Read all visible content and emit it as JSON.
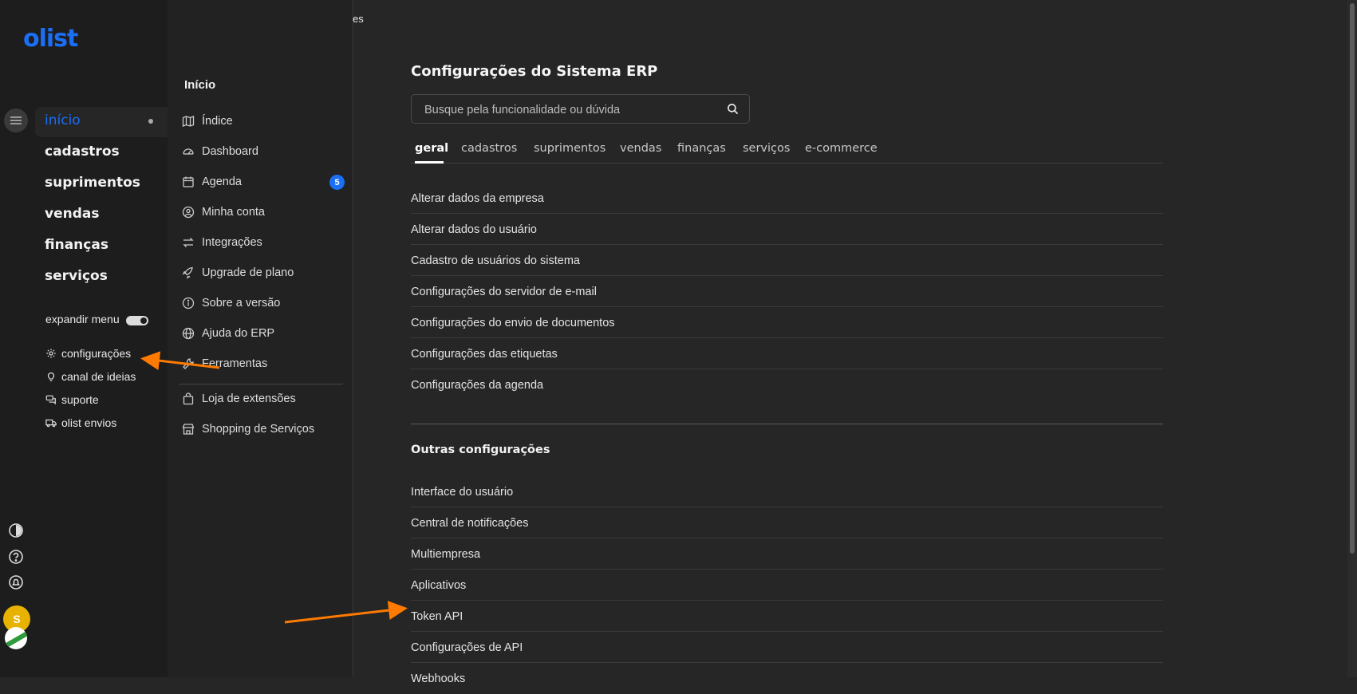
{
  "rail": {
    "logo": "olist",
    "nav": [
      {
        "label": "início",
        "active": true
      },
      {
        "label": "cadastros"
      },
      {
        "label": "suprimentos"
      },
      {
        "label": "vendas"
      },
      {
        "label": "finanças"
      },
      {
        "label": "serviços"
      }
    ],
    "expand_menu_label": "expandir menu",
    "utilities": [
      {
        "label": "configurações",
        "icon": "gear-icon"
      },
      {
        "label": "canal de ideias",
        "icon": "lightbulb-icon"
      },
      {
        "label": "suporte",
        "icon": "chat-icon"
      },
      {
        "label": "olist envios",
        "icon": "truck-icon"
      }
    ],
    "avatar_initial": "S",
    "avatar_color": "#e8b300",
    "accent_color": "#1a6ff5"
  },
  "submenu": {
    "title": "Início",
    "items": [
      {
        "label": "Índice",
        "icon": "map-icon"
      },
      {
        "label": "Dashboard",
        "icon": "gauge-icon"
      },
      {
        "label": "Agenda",
        "icon": "calendar-icon",
        "badge": "5"
      },
      {
        "label": "Minha conta",
        "icon": "user-circle-icon"
      },
      {
        "label": "Integrações",
        "icon": "swap-icon"
      },
      {
        "label": "Upgrade de plano",
        "icon": "rocket-icon"
      },
      {
        "label": "Sobre a versão",
        "icon": "info-icon"
      },
      {
        "label": "Ajuda do ERP",
        "icon": "globe-icon"
      },
      {
        "label": "Ferramentas",
        "icon": "wrench-icon"
      },
      {
        "label": "Loja de extensões",
        "icon": "bag-icon"
      },
      {
        "label": "Shopping de Serviços",
        "icon": "store-icon"
      }
    ],
    "top_stub": "es"
  },
  "main": {
    "title": "Configurações do Sistema ERP",
    "search": {
      "placeholder": "Busque pela funcionalidade ou dúvida",
      "value": ""
    },
    "tabs": [
      "geral",
      "cadastros",
      "suprimentos",
      "vendas",
      "finanças",
      "serviços",
      "e-commerce"
    ],
    "active_tab": "geral",
    "general_items": [
      "Alterar dados da empresa",
      "Alterar dados do usuário",
      "Cadastro de usuários do sistema",
      "Configurações do servidor de e-mail",
      "Configurações do envio de documentos",
      "Configurações das etiquetas",
      "Configurações da agenda"
    ],
    "other_title": "Outras configurações",
    "other_items": [
      "Interface do usuário",
      "Central de notificações",
      "Multiempresa",
      "Aplicativos",
      "Token API",
      "Configurações de API",
      "Webhooks"
    ]
  },
  "annotation_color": "#ff7a00"
}
